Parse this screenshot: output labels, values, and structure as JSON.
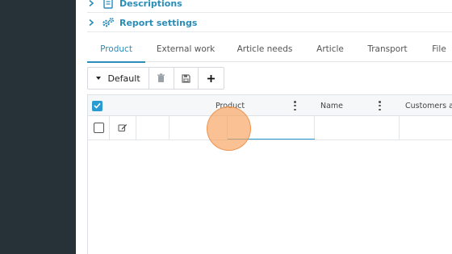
{
  "sections": {
    "descriptions": "Descriptions",
    "report_settings": "Report settings"
  },
  "tabs": [
    {
      "label": "Product",
      "active": true
    },
    {
      "label": "External work",
      "active": false
    },
    {
      "label": "Article needs",
      "active": false
    },
    {
      "label": "Article",
      "active": false
    },
    {
      "label": "Transport",
      "active": false
    },
    {
      "label": "File",
      "active": false
    }
  ],
  "toolbar": {
    "view_label": "Default",
    "icons": [
      "caret-down-icon",
      "trash-icon",
      "save-icon",
      "plus-icon"
    ]
  },
  "grid": {
    "columns": [
      "Product",
      "Name",
      "Customers ar"
    ],
    "select_all_checked": true,
    "rows": [
      {
        "checked": false,
        "product": "",
        "name": "",
        "customers": ""
      }
    ]
  },
  "colors": {
    "sidebar": "#263238",
    "accent": "#2a8db8",
    "checkbox": "#2a9bd1",
    "cursor_highlight": "#f7a15a"
  }
}
